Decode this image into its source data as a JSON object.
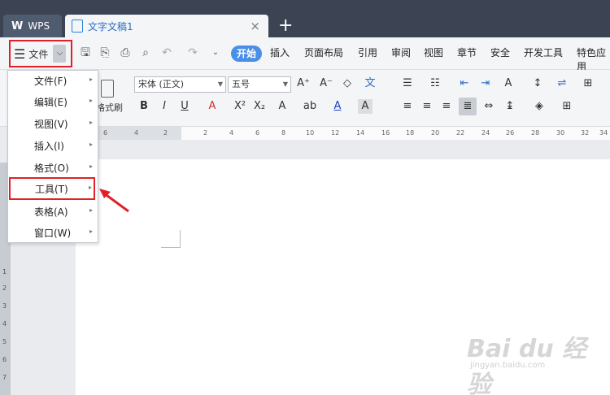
{
  "titlebar": {
    "app_tab_label": "WPS",
    "app_tab_logo": "W",
    "doc_tab_label": "文字文稿1",
    "close_symbol": "×",
    "new_tab_symbol": "+"
  },
  "menubar": {
    "file_label": "文件",
    "items": [
      "插入",
      "页面布局",
      "引用",
      "审阅",
      "视图",
      "章节",
      "安全",
      "开发工具",
      "特色应用"
    ],
    "active_tab": "开始"
  },
  "ribbon": {
    "font_name": "宋体 (正文)",
    "font_size": "五号",
    "format_painter_label": "格式刷"
  },
  "file_menu": {
    "items": [
      {
        "label": "文件(F)"
      },
      {
        "label": "编辑(E)"
      },
      {
        "label": "视图(V)"
      },
      {
        "label": "插入(I)"
      },
      {
        "label": "格式(O)"
      },
      {
        "label": "工具(T)",
        "highlighted": true
      },
      {
        "label": "表格(A)"
      },
      {
        "label": "窗口(W)"
      }
    ]
  },
  "ruler_ticks": [
    "6",
    "4",
    "2",
    "2",
    "4",
    "6",
    "8",
    "10",
    "12",
    "14",
    "16",
    "18",
    "20",
    "22",
    "24",
    "26",
    "28",
    "30",
    "32",
    "34"
  ],
  "vruler_ticks": [
    "1",
    "2",
    "3",
    "4",
    "5",
    "6",
    "7"
  ],
  "watermark": {
    "main": "Bai du 经验",
    "sub": "jingyan.baidu.com"
  },
  "colors": {
    "titlebar": "#3c4453",
    "accent_blue": "#4a8fe7",
    "highlight_red": "#e0202a"
  }
}
